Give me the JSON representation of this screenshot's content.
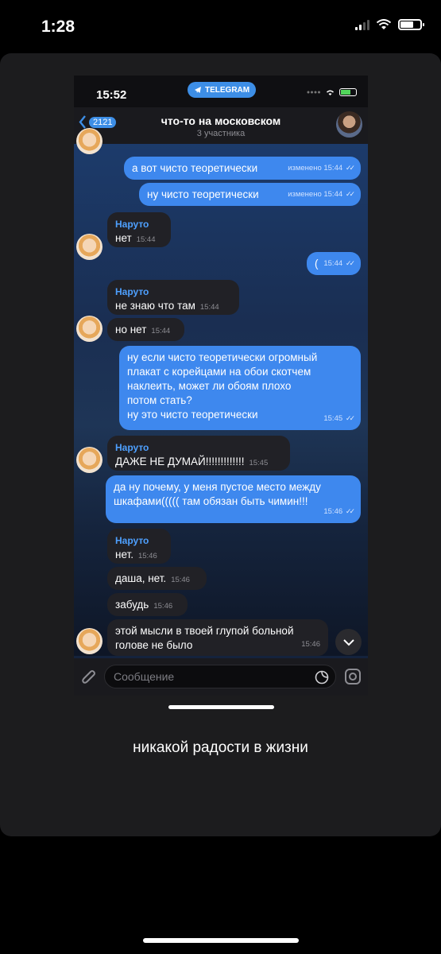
{
  "device_status": {
    "time": "1:28"
  },
  "inner_status": {
    "time": "15:52",
    "app_pill": "TELEGRAM"
  },
  "chat_header": {
    "back_count": "2121",
    "title": "что-то на московском",
    "subtitle": "3 участника"
  },
  "messages": [
    {
      "dir": "out",
      "text": "а вот чисто теоретически",
      "meta": "изменено 15:44"
    },
    {
      "dir": "out",
      "text": "ну чисто теоретически",
      "meta": "изменено 15:44"
    },
    {
      "dir": "in",
      "sender": "Наруто",
      "text": "нет",
      "meta": "15:44"
    },
    {
      "dir": "out",
      "text": "(",
      "meta": "15:44"
    },
    {
      "dir": "in",
      "sender": "Наруто",
      "text": "не знаю что там",
      "meta": "15:44"
    },
    {
      "dir": "in",
      "text": "но нет",
      "meta": "15:44"
    },
    {
      "dir": "out",
      "text": "ну если чисто теоретически огромный плакат с корейцами на обои скотчем наклеить, может ли обоям плохо потом стать?\nну это чисто теоретически",
      "meta": "15:45"
    },
    {
      "dir": "in",
      "sender": "Наруто",
      "text": "ДАЖЕ НЕ ДУМАЙ!!!!!!!!!!!!!",
      "meta": "15:45"
    },
    {
      "dir": "out",
      "text": "да ну почему, у меня пустое место между шкафами((((( там обязан быть чимин!!!",
      "meta": "15:46"
    },
    {
      "dir": "in",
      "sender": "Наруто",
      "text": "нет.",
      "meta": "15:46"
    },
    {
      "dir": "in",
      "text": "даша, нет.",
      "meta": "15:46"
    },
    {
      "dir": "in",
      "text": "забудь",
      "meta": "15:46"
    },
    {
      "dir": "in",
      "text": "этой мысли в твоей глупой больной голове не было",
      "meta": "15:46"
    }
  ],
  "input": {
    "placeholder": "Сообщение"
  },
  "caption": "никакой радости в жизни",
  "colors": {
    "outgoing": "#3e88ee",
    "incoming": "#212126",
    "accent": "#4ea0ff"
  }
}
